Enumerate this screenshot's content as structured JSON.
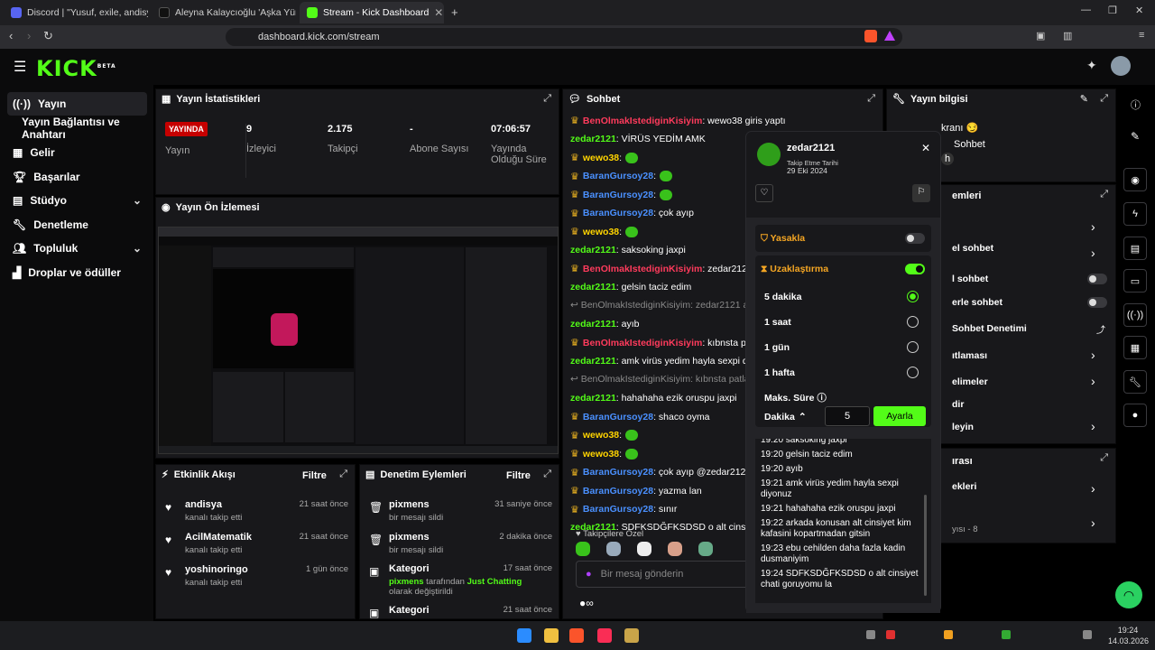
{
  "browser": {
    "tabs": [
      {
        "title": "Discord | \"Yusuf, exile, andisya b"
      },
      {
        "title": "Aleyna Kalaycıoğlu 'Aşka Yürek Gerek"
      },
      {
        "title": "Stream - Kick Dashboard"
      }
    ],
    "url": "dashboard.kick.com/stream"
  },
  "brand": {
    "logo": "KICK",
    "beta": "BETA",
    "accent": "#53fc18"
  },
  "sidebar": {
    "items": [
      {
        "label": "Yayın",
        "icon": "broadcast-icon"
      },
      {
        "label": "Yayın Bağlantısı ve Anahtarı"
      },
      {
        "label": "Gelir",
        "icon": "chart-icon"
      },
      {
        "label": "Başarılar",
        "icon": "trophy-icon"
      },
      {
        "label": "Stüdyo",
        "icon": "studio-icon"
      },
      {
        "label": "Denetleme",
        "icon": "wrench-icon"
      },
      {
        "label": "Topluluk",
        "icon": "people-icon"
      },
      {
        "label": "Droplar ve ödüller",
        "icon": "gift-icon"
      }
    ]
  },
  "stats": {
    "title": "Yayın İstatistikleri",
    "live_badge": "YAYINDA",
    "live_label": "Yayın",
    "viewers": "9",
    "viewers_label": "İzleyici",
    "followers": "2.175",
    "followers_label": "Takipçi",
    "subs": "-",
    "subs_label": "Abone Sayısı",
    "uptime": "07:06:57",
    "uptime_label": "Yayında Olduğu Süre"
  },
  "preview": {
    "title": "Yayın Ön İzlemesi"
  },
  "activity": {
    "title": "Etkinlik Akışı",
    "filter": "Filtre",
    "rows": [
      {
        "name": "andisya",
        "sub": "kanalı takip etti",
        "time": "21 saat önce"
      },
      {
        "name": "AcilMatematik",
        "sub": "kanalı takip etti",
        "time": "21 saat önce"
      },
      {
        "name": "yoshinoringo",
        "sub": "kanalı takip etti",
        "time": "1 gün önce"
      }
    ]
  },
  "modlog": {
    "title": "Denetim Eylemleri",
    "filter": "Filtre",
    "rows": [
      {
        "name": "pixmens",
        "sub": "bir mesajı sildi",
        "time": "31 saniye önce"
      },
      {
        "name": "pixmens",
        "sub": "bir mesajı sildi",
        "time": "2 dakika önce"
      },
      {
        "name": "Kategori",
        "sub_user": "pixmens",
        "sub_mid": " tarafından ",
        "sub_cat": "Just Chatting",
        "sub_end": " olarak değiştirildi",
        "time": "17 saat önce"
      },
      {
        "name": "Kategori",
        "sub": "",
        "time": "21 saat önce"
      }
    ]
  },
  "chat": {
    "title": "Sohbet",
    "lines": [
      {
        "crown": true,
        "user": "BenOlmakIstediginKisiyim",
        "color": "uR",
        "text": ": wewo38 giris yaptı"
      },
      {
        "crown": false,
        "user": "zedar2121",
        "color": "uG",
        "text": ": VİRÜS YEDİM AMK"
      },
      {
        "crown": true,
        "user": "wewo38",
        "color": "uY",
        "text": ":",
        "emote": true
      },
      {
        "crown": true,
        "user": "BaranGursoy28",
        "color": "uB",
        "text": ":",
        "emote": true
      },
      {
        "crown": true,
        "user": "BaranGursoy28",
        "color": "uB",
        "text": ":",
        "emote": true
      },
      {
        "crown": true,
        "user": "BaranGursoy28",
        "color": "uB",
        "text": ": çok ayıp"
      },
      {
        "crown": true,
        "user": "wewo38",
        "color": "uY",
        "text": ":",
        "emote": true
      },
      {
        "crown": false,
        "user": "zedar2121",
        "color": "uG",
        "text": ": saksoking jaxpi"
      },
      {
        "crown": true,
        "user": "BenOlmakIstediginKisiyim",
        "color": "uR",
        "text": ": zedar2121 a"
      },
      {
        "crown": false,
        "user": "zedar2121",
        "color": "uG",
        "text": ": gelsin taciz edim"
      },
      {
        "crown": false,
        "sys": true,
        "text": "↩ BenOlmakIstediginKisiyim: zedar2121 adlı ka"
      },
      {
        "crown": false,
        "user": "zedar2121",
        "color": "uG",
        "text": ": ayıb"
      },
      {
        "crown": true,
        "user": "BenOlmakIstediginKisiyim",
        "color": "uR",
        "text": ": kıbnsta patl"
      },
      {
        "crown": false,
        "user": "zedar2121",
        "color": "uG",
        "text": ": amk virüs yedim hayla sexpi diy"
      },
      {
        "crown": false,
        "sys": true,
        "text": "↩ BenOlmakIstediginKisiyim: kıbnsta patlamış"
      },
      {
        "crown": false,
        "user": "zedar2121",
        "color": "uG",
        "text": ": hahahaha ezik oruspu jaxpi"
      },
      {
        "crown": true,
        "user": "BaranGursoy28",
        "color": "uB",
        "text": ": shaco oyma"
      },
      {
        "crown": true,
        "user": "wewo38",
        "color": "uY",
        "text": ":",
        "emote": true
      },
      {
        "crown": true,
        "user": "wewo38",
        "color": "uY",
        "text": ":",
        "emote": true
      },
      {
        "crown": true,
        "user": "BaranGursoy28",
        "color": "uB",
        "text": ": çok ayıp @zedar2121"
      },
      {
        "crown": true,
        "user": "BaranGursoy28",
        "color": "uB",
        "text": ": yazma lan"
      },
      {
        "crown": true,
        "user": "BaranGursoy28",
        "color": "uB",
        "text": ": sınır"
      },
      {
        "crown": false,
        "user": "zedar2121",
        "color": "uG",
        "text": ": SDFKSDĞFKSDSD o alt cinsiyet"
      }
    ],
    "followers_only": "Takipçilere Özel",
    "input_placeholder": "Bir mesaj gönderin"
  },
  "popup": {
    "user": "zedar2121",
    "follow_label": "Takip Etme Tarihi",
    "follow_date": "29 Eki 2024",
    "ban_label": "Yasakla",
    "timeout_label": "Uzaklaştırma",
    "options": [
      "5 dakika",
      "1 saat",
      "1 gün",
      "1 hafta"
    ],
    "selected": 0,
    "max_label": "Maks. Süre",
    "unit": "Dakika",
    "value": "5",
    "apply": "Ayarla",
    "history": [
      "19:20 saksoking jaxpi",
      "19:20 gelsin taciz edim",
      "19:20 ayıb",
      "19:21 amk virüs yedim hayla sexpi diyonuz",
      "19:21 hahahaha ezik oruspu jaxpi",
      "19:22 arkada konusan alt cinsiyet kim kafasini kopartmadan gitsin",
      "19:23 ebu cehilden daha fazla kadin dusmaniyim",
      "19:24 SDFKSDĞFKSDSD o alt cinsiyet chati goruyomu la"
    ]
  },
  "info": {
    "title": "Yayın bilgisi",
    "line1": "kranı 😏",
    "line2": "Sohbet",
    "line3": "h",
    "section2_title": "emleri",
    "rows": [
      "el sohbet",
      "l sohbet",
      "erle sohbet",
      "Sohbet Denetimi",
      "ıtlaması",
      "elimeler",
      "dir",
      "leyin"
    ],
    "section3_title": "ırası",
    "row3": "ekleri",
    "row4": "yısı - 8"
  },
  "taskbar": {
    "time": "19:24",
    "date": "14.03.2026"
  }
}
